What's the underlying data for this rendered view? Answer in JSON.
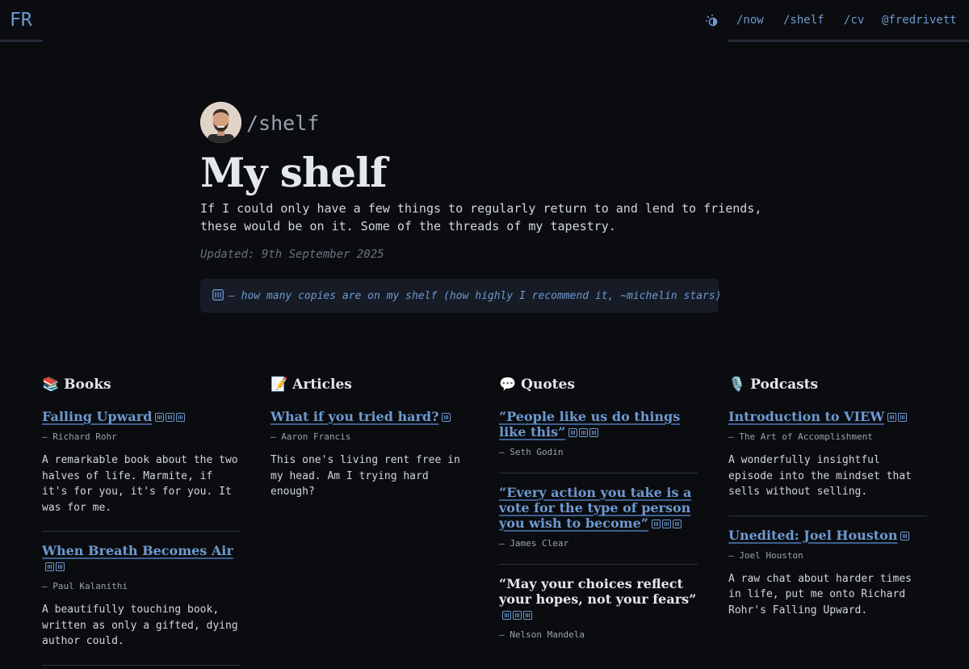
{
  "header": {
    "logo": "FR",
    "nav": [
      "/now",
      "/shelf",
      "/cv",
      "@fredrivett"
    ]
  },
  "hero": {
    "breadcrumb": "/shelf",
    "title": "My shelf",
    "description": "If I could only have a few things to regularly return to and lend to friends, these would be on it. Some of the threads of my tapestry.",
    "updated": "Updated: 9th September 2025",
    "legend": "– how many copies are on my shelf (how highly I recommend it, ~michelin stars)"
  },
  "columns": {
    "books": {
      "emoji": "📚",
      "title": "Books",
      "items": [
        {
          "title": "Falling Upward",
          "copies": 3,
          "author": "– Richard Rohr",
          "note": "A remarkable book about the two halves of life. Marmite, if it's for you, it's for you. It was for me."
        },
        {
          "title": "When Breath Becomes Air",
          "copies": 2,
          "author": "– Paul Kalanithi",
          "note": "A beautifully touching book, written as only a gifted, dying author could."
        }
      ]
    },
    "articles": {
      "emoji": "📝",
      "title": "Articles",
      "items": [
        {
          "title": "What if you tried hard?",
          "copies": 1,
          "author": "– Aaron Francis",
          "note": "This one's living rent free in my head. Am I trying hard enough?"
        }
      ]
    },
    "quotes": {
      "emoji": "💬",
      "title": "Quotes",
      "items": [
        {
          "title": "“People like us do things like this”",
          "copies": 3,
          "author": "– Seth Godin"
        },
        {
          "title": "“Every action you take is a vote for the type of person you wish to become”",
          "copies": 3,
          "author": "– James Clear"
        },
        {
          "title": "“May your choices reflect your hopes, not your fears”",
          "copies": 3,
          "author": "– Nelson Mandela"
        }
      ]
    },
    "podcasts": {
      "emoji": "🎙️",
      "title": "Podcasts",
      "items": [
        {
          "title": "Introduction to VIEW",
          "copies": 2,
          "author": "– The Art of Accomplishment",
          "note": "A wonderfully insightful episode into the mindset that sells without selling."
        },
        {
          "title": "Unedited: Joel Houston",
          "copies": 1,
          "author": "– Joel Houston",
          "note": "A raw chat about harder times in life, put me onto Richard Rohr's Falling Upward."
        }
      ]
    }
  },
  "colors": {
    "background": "#0b0c10",
    "accent": "#6d9ad0",
    "text": "#d2d6dd",
    "muted": "#6b7280"
  }
}
